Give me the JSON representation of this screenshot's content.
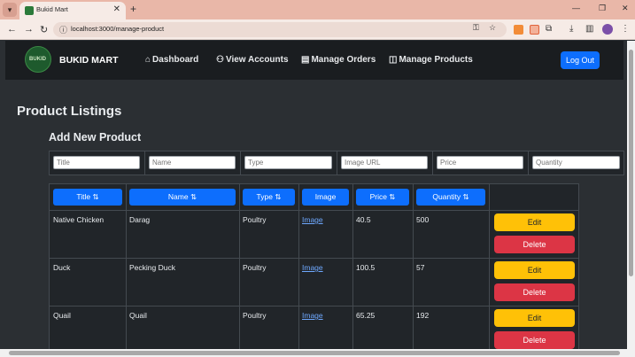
{
  "browser": {
    "tab_title": "Bukid Mart",
    "url": "localhost:3000/manage-product",
    "tab_close": "✕",
    "new_tab": "+"
  },
  "navbar": {
    "logo_text": "BUKID",
    "brand": "BUKID MART",
    "items": [
      {
        "label": "Dashboard",
        "icon": "home-icon"
      },
      {
        "label": "View Accounts",
        "icon": "person-icon"
      },
      {
        "label": "Manage Orders",
        "icon": "list-icon"
      },
      {
        "label": "Manage Products",
        "icon": "bag-icon"
      }
    ],
    "logout": "Log Out"
  },
  "page": {
    "title": "Product Listings",
    "subtitle": "Add New Product"
  },
  "add_form": {
    "placeholders": [
      "Title",
      "Name",
      "Type",
      "Image URL",
      "Price",
      "Quantity"
    ]
  },
  "table": {
    "headers": [
      "Title ⇅",
      "Name ⇅",
      "Type ⇅",
      "Image",
      "Price ⇅",
      "Quantity ⇅"
    ],
    "rows": [
      {
        "title": "Native Chicken",
        "name": "Darag",
        "type": "Poultry",
        "image": "Image",
        "price": "40.5",
        "quantity": "500"
      },
      {
        "title": "Duck",
        "name": "Pecking Duck",
        "type": "Poultry",
        "image": "Image",
        "price": "100.5",
        "quantity": "57"
      },
      {
        "title": "Quail",
        "name": "Quail",
        "type": "Poultry",
        "image": "Image",
        "price": "65.25",
        "quantity": "192"
      }
    ],
    "edit_label": "Edit",
    "delete_label": "Delete"
  },
  "colors": {
    "primary": "#0d6efd",
    "warning": "#ffc107",
    "danger": "#dc3545",
    "background": "#2b2f33"
  }
}
